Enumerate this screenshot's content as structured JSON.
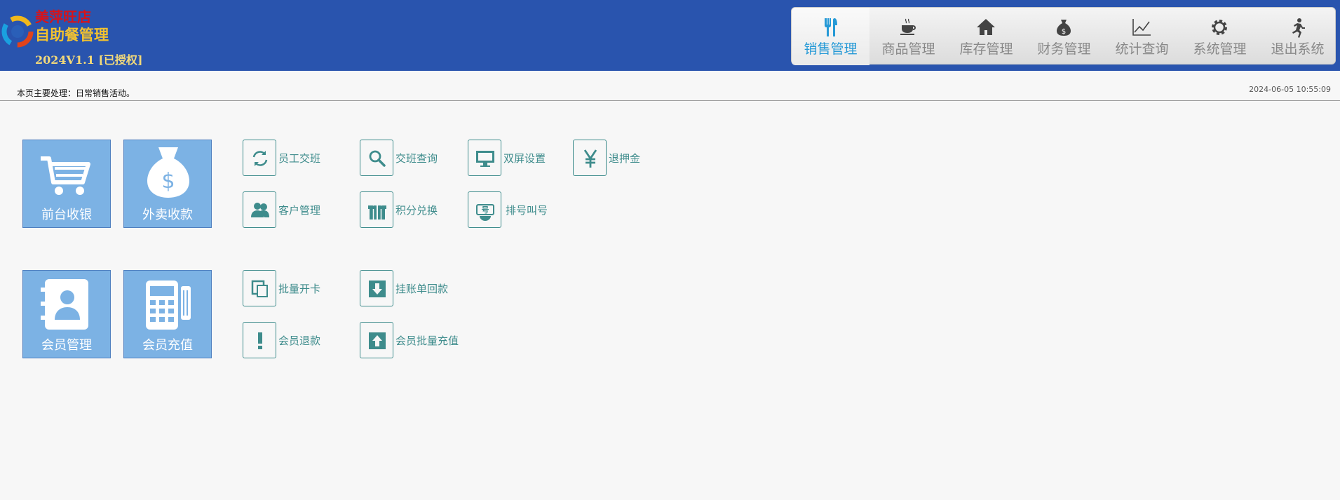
{
  "app": {
    "brand_line1": "美萍旺店",
    "brand_line2": "自助餐管理",
    "version": "2024V1.1 [已授权]"
  },
  "nav": {
    "items": [
      {
        "label": "销售管理",
        "icon": "fork-knife-icon",
        "active": true
      },
      {
        "label": "商品管理",
        "icon": "coffee-cup-icon",
        "active": false
      },
      {
        "label": "库存管理",
        "icon": "house-icon",
        "active": false
      },
      {
        "label": "财务管理",
        "icon": "money-bag-icon",
        "active": false
      },
      {
        "label": "统计查询",
        "icon": "line-chart-icon",
        "active": false
      },
      {
        "label": "系统管理",
        "icon": "gear-icon",
        "active": false
      },
      {
        "label": "退出系统",
        "icon": "running-man-icon",
        "active": false
      }
    ],
    "active_color": "#2599d6",
    "inactive_color": "#888888"
  },
  "status": {
    "notice": "本页主要处理：日常销售活动。",
    "datetime": "2024-06-05 10:55:09"
  },
  "tiles": [
    {
      "label": "前台收银",
      "icon": "shopping-cart-icon"
    },
    {
      "label": "外卖收款",
      "icon": "money-bag-icon"
    },
    {
      "label": "会员管理",
      "icon": "contact-book-icon"
    },
    {
      "label": "会员充值",
      "icon": "pos-terminal-icon"
    }
  ],
  "items": [
    {
      "label": "员工交班",
      "icon": "refresh-icon"
    },
    {
      "label": "交班查询",
      "icon": "search-icon"
    },
    {
      "label": "双屏设置",
      "icon": "monitor-icon"
    },
    {
      "label": "退押金",
      "icon": "yen-icon"
    },
    {
      "label": "客户管理",
      "icon": "users-icon"
    },
    {
      "label": "积分兑换",
      "icon": "gift-icon"
    },
    {
      "label": "排号叫号",
      "icon": "queue-ticket-icon"
    },
    {
      "label": "批量开卡",
      "icon": "copy-icon"
    },
    {
      "label": "挂账单回款",
      "icon": "download-icon"
    },
    {
      "label": "会员退款",
      "icon": "exclamation-icon"
    },
    {
      "label": "会员批量充值",
      "icon": "upload-icon"
    }
  ],
  "colors": {
    "header_bg": "#2954ae",
    "tile_bg": "#7cb2e4",
    "item_accent": "#3e8c8c"
  }
}
